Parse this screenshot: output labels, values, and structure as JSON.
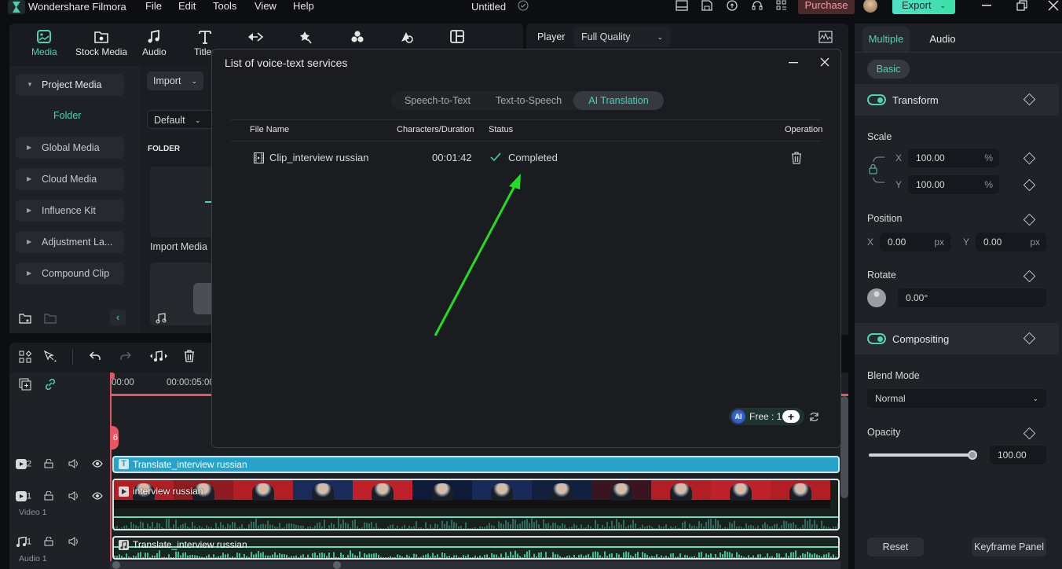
{
  "app": {
    "name": "Wondershare Filmora",
    "doc_title": "Untitled"
  },
  "menu": [
    "File",
    "Edit",
    "Tools",
    "View",
    "Help"
  ],
  "titlebar": {
    "purchase": "Purchase",
    "export": "Export"
  },
  "toolbar": {
    "tabs": [
      {
        "label": "Media",
        "icon": "media-icon",
        "active": true
      },
      {
        "label": "Stock Media",
        "icon": "stock-media-icon"
      },
      {
        "label": "Audio",
        "icon": "music-note-icon"
      },
      {
        "label": "Titles",
        "icon": "text-t-icon"
      },
      {
        "label": "",
        "icon": "transitions-icon"
      },
      {
        "label": "",
        "icon": "effects-icon"
      },
      {
        "label": "",
        "icon": "elements-icon"
      },
      {
        "label": "",
        "icon": "stickers-icon"
      },
      {
        "label": "",
        "icon": "templates-icon"
      }
    ]
  },
  "media_panel": {
    "sidebar": [
      {
        "label": "Project Media",
        "expanded": true
      },
      {
        "label": "Global Media"
      },
      {
        "label": "Cloud Media"
      },
      {
        "label": "Influence Kit"
      },
      {
        "label": "Adjustment La..."
      },
      {
        "label": "Compound Clip"
      }
    ],
    "folder_label": "Folder",
    "import_label": "Import",
    "sort_label": "Default",
    "section_label": "FOLDER",
    "import_media_label": "Import Media"
  },
  "player": {
    "label": "Player",
    "quality": "Full Quality"
  },
  "right_panel": {
    "tabs": [
      "Multiple",
      "Audio"
    ],
    "sub_tab": "Basic",
    "transform": {
      "title": "Transform",
      "enabled": true
    },
    "scale": {
      "label": "Scale",
      "x": "100.00",
      "y": "100.00",
      "unit": "%"
    },
    "position": {
      "label": "Position",
      "x": "0.00",
      "y": "0.00",
      "unit": "px"
    },
    "rotate": {
      "label": "Rotate",
      "value": "0.00°"
    },
    "compositing": {
      "title": "Compositing",
      "enabled": true
    },
    "blend_mode": {
      "label": "Blend Mode",
      "value": "Normal"
    },
    "opacity": {
      "label": "Opacity",
      "value": "100.00",
      "fraction": 1.0
    },
    "reset": "Reset",
    "keyframe_panel": "Keyframe Panel",
    "axis_x": "X",
    "axis_y": "Y"
  },
  "timeline": {
    "ruler": [
      "00:00",
      "00:00:05:00"
    ],
    "playhead_marker": "6",
    "tracks": [
      {
        "icon": "video-track-icon",
        "number": "2",
        "name": ""
      },
      {
        "icon": "video-track-icon",
        "number": "1",
        "name": "Video 1"
      },
      {
        "icon": "audio-track-icon",
        "number": "1",
        "name": "Audio 1"
      }
    ],
    "clips": {
      "title": "Translate_interview russian",
      "video": "interview russian",
      "audio": "Translate_interview russian"
    }
  },
  "modal": {
    "title": "List of voice-text services",
    "tabs": [
      "Speech-to-Text",
      "Text-to-Speech",
      "AI Translation"
    ],
    "active_tab": "AI Translation",
    "columns": [
      "File Name",
      "Characters/Duration",
      "Status",
      "Operation"
    ],
    "rows": [
      {
        "file_name": "Clip_interview russian",
        "duration": "00:01:42",
        "status": "Completed"
      }
    ],
    "free_label": "Free : 1",
    "ai_badge": "AI"
  },
  "colors": {
    "accent": "#4fd1b4",
    "annotation_arrow": "#22dd22",
    "playhead": "#e8575f",
    "title_clip": "#27a3c9"
  }
}
